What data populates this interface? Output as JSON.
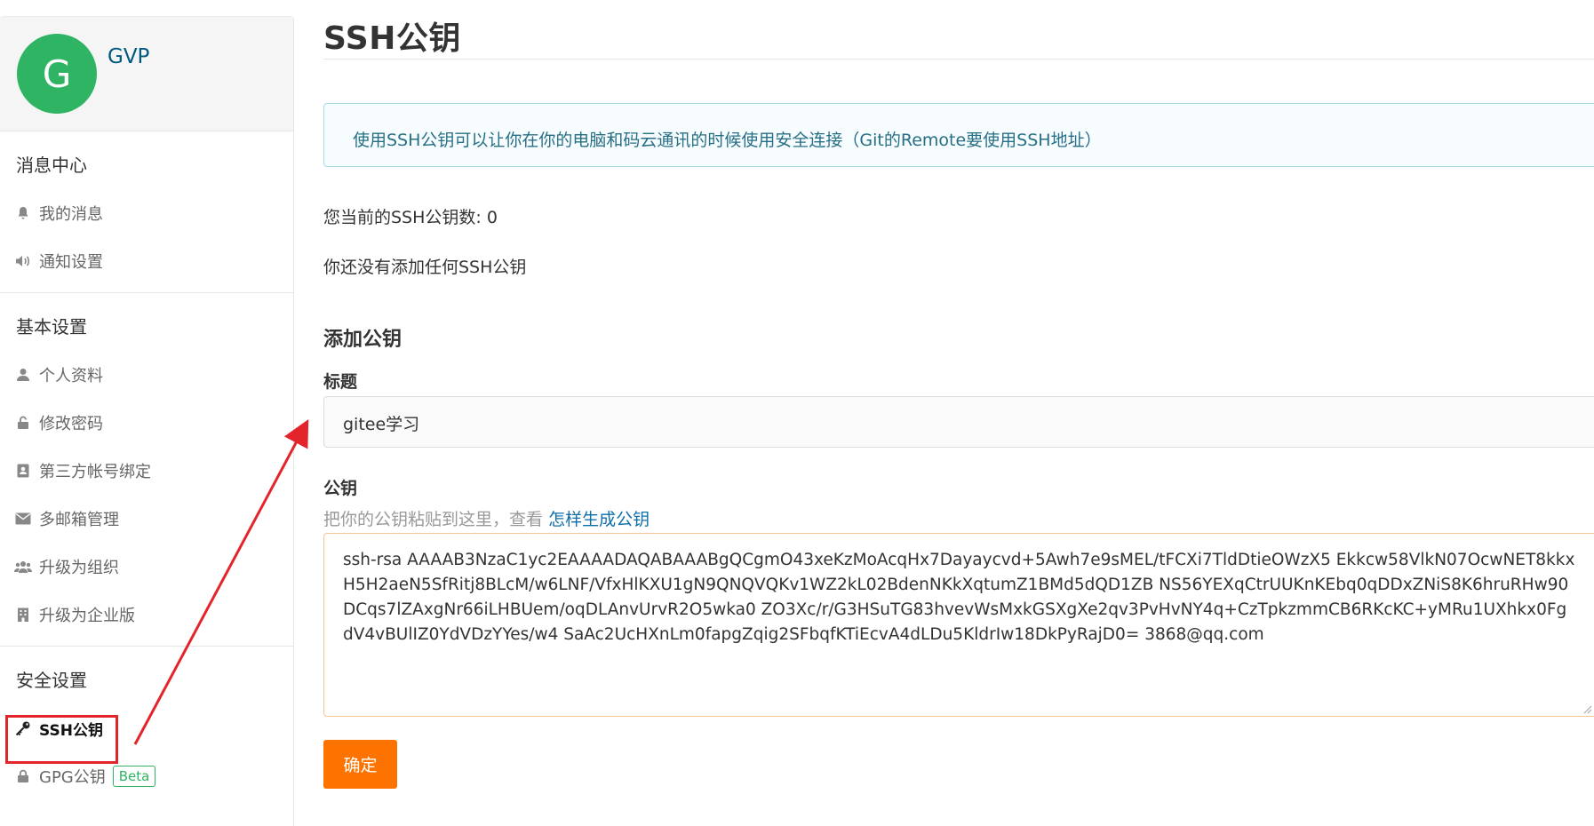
{
  "profile": {
    "avatar_letter": "G",
    "username": "GVP"
  },
  "sidebar": {
    "groups": [
      {
        "title": "消息中心",
        "items": [
          {
            "label": "我的消息",
            "icon": "bell-icon"
          },
          {
            "label": "通知设置",
            "icon": "volume-icon"
          }
        ]
      },
      {
        "title": "基本设置",
        "items": [
          {
            "label": "个人资料",
            "icon": "user-icon"
          },
          {
            "label": "修改密码",
            "icon": "unlock-icon"
          },
          {
            "label": "第三方帐号绑定",
            "icon": "contact-card-icon"
          },
          {
            "label": "多邮箱管理",
            "icon": "envelope-icon"
          },
          {
            "label": "升级为组织",
            "icon": "users-icon"
          },
          {
            "label": "升级为企业版",
            "icon": "building-icon"
          }
        ]
      },
      {
        "title": "安全设置",
        "items": [
          {
            "label": "SSH公钥",
            "icon": "key-icon",
            "active": true
          },
          {
            "label": "GPG公钥",
            "icon": "lock-icon",
            "badge": "Beta"
          }
        ]
      }
    ]
  },
  "main": {
    "title": "SSH公钥",
    "info": "使用SSH公钥可以让你在你的电脑和码云通讯的时候使用安全连接（Git的Remote要使用SSH地址）",
    "count_text": "您当前的SSH公钥数: 0",
    "empty_text": "你还没有添加任何SSH公钥",
    "add_heading": "添加公钥",
    "title_label": "标题",
    "title_value": "gitee学习",
    "key_label": "公钥",
    "key_hint": "把你的公钥粘贴到这里，查看",
    "key_hint_link": "怎样生成公钥",
    "key_value": "ssh-rsa AAAAB3NzaC1yc2EAAAADAQABAAABgQCgmO43xeKzMoAcqHx7Dayaycvd+5Awh7e9sMEL/tFCXi7TldDtieOWzX5 Ekkcw58VlkN07OcwNET8kkxH5H2aeN5SfRitj8BLcM/w6LNF/VfxHlKXU1gN9QNQVQKv1WZ2kL02BdenNKkXqtumZ1BMd5dQD1ZB NS56YEXqCtrUUKnKEbq0qDDxZNiS8K6hruRHw90DCqs7lZAxgNr66iLHBUem/oqDLAnvUrvR2O5wka0 ZO3Xc/r/G3HSuTG83hvevWsMxkGSXgXe2qv3PvHvNY4q+CzTpkzmmCB6RKcKC+yMRu1UXhkx0FgdV4vBUlIZ0YdVDzYYes/w4 SaAc2UcHXnLm0fapgZqig2SFbqfKTiEcvA4dLDu5KldrIw18DkPyRajD0= 3868@qq.com",
    "submit_label": "确定"
  },
  "annotation": {
    "color": "#e3242b"
  }
}
